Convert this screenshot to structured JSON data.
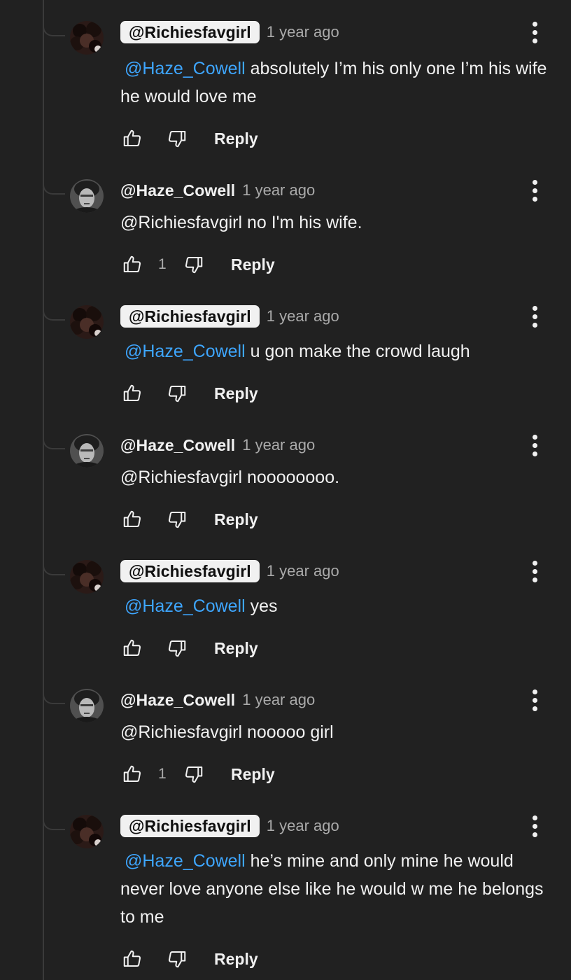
{
  "comments": [
    {
      "author": "@Richiesfavgirl",
      "highlighted": true,
      "time": "1 year ago",
      "mention": "@Haze_Cowell",
      "text": "absolutely I’m his only one I’m his wife he would love me",
      "likes": "",
      "reply": "Reply",
      "avatar": "dark-curly-hair-avatar"
    },
    {
      "author": "@Haze_Cowell",
      "highlighted": false,
      "time": "1 year ago",
      "mention": "",
      "text": "@Richiesfavgirl no I'm his wife.",
      "likes": "1",
      "reply": "Reply",
      "avatar": "grayscale-portrait-avatar"
    },
    {
      "author": "@Richiesfavgirl",
      "highlighted": true,
      "time": "1 year ago",
      "mention": "@Haze_Cowell",
      "text": "u gon make the crowd laugh",
      "likes": "",
      "reply": "Reply",
      "avatar": "dark-curly-hair-avatar"
    },
    {
      "author": "@Haze_Cowell",
      "highlighted": false,
      "time": "1 year ago",
      "mention": "",
      "text": "@Richiesfavgirl noooooooo.",
      "likes": "",
      "reply": "Reply",
      "avatar": "grayscale-portrait-avatar"
    },
    {
      "author": "@Richiesfavgirl",
      "highlighted": true,
      "time": "1 year ago",
      "mention": "@Haze_Cowell",
      "text": "yes",
      "likes": "",
      "reply": "Reply",
      "avatar": "dark-curly-hair-avatar"
    },
    {
      "author": "@Haze_Cowell",
      "highlighted": false,
      "time": "1 year ago",
      "mention": "",
      "text": "@Richiesfavgirl nooooo girl",
      "likes": "1",
      "reply": "Reply",
      "avatar": "grayscale-portrait-avatar"
    },
    {
      "author": "@Richiesfavgirl",
      "highlighted": true,
      "time": "1 year ago",
      "mention": "@Haze_Cowell",
      "text": "he’s mine and only mine he would never love anyone else like he would w me he belongs to me",
      "likes": "",
      "reply": "Reply",
      "avatar": "dark-curly-hair-avatar"
    }
  ],
  "icons": {
    "like": "thumbs-up-icon",
    "dislike": "thumbs-down-icon",
    "menu": "more-vert-icon"
  },
  "colors": {
    "background": "#212121",
    "mention": "#3ea6ff",
    "pill": "#f1f1f1",
    "secondary_text": "#aaaaaa"
  }
}
